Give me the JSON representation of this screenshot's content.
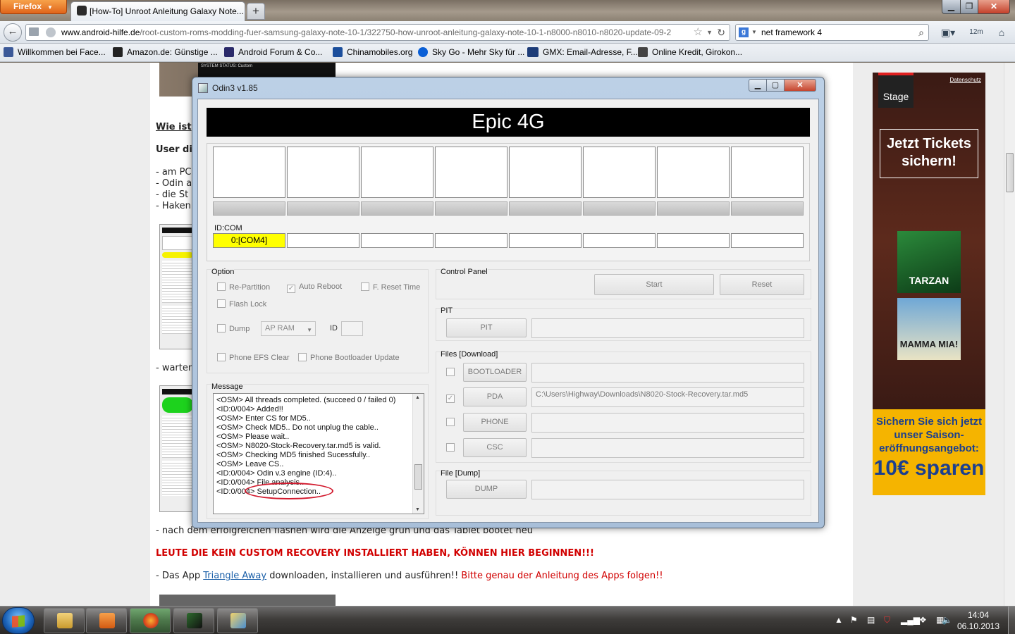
{
  "browser": {
    "menu_button": "Firefox",
    "tab_title": "[How-To] Unroot Anleitung Galaxy Note...",
    "new_tab": "+",
    "url_host": "www.android-hilfe.de",
    "url_path": "/root-custom-roms-modding-fuer-samsung-galaxy-note-10-1/322750-how-unroot-anleitung-galaxy-note-10-1-n8000-n8010-n8020-update-09-2",
    "search_value": "net framework 4",
    "bookmarks": [
      {
        "label": "Willkommen bei Face...",
        "color": "#3b5998"
      },
      {
        "label": "Amazon.de: Günstige ...",
        "color": "#222222"
      },
      {
        "label": "Android Forum & Co...",
        "color": "#2a2a6a"
      },
      {
        "label": "Chinamobiles.org",
        "color": "#1c4f9c"
      },
      {
        "label": "Sky Go - Mehr Sky für ...",
        "color": "#0a5fd6"
      },
      {
        "label": "GMX: Email-Adresse, F...",
        "color": "#1d3c78"
      },
      {
        "label": "Online Kredit, Girokon...",
        "color": "#444444"
      }
    ]
  },
  "page": {
    "image_caption": "SYSTEM STATUS: Custom",
    "heading_1": "Wie ist",
    "heading_2": "User di",
    "list_items": [
      "- am PC",
      "- Odin a",
      "- die St",
      "- Haken"
    ],
    "warten": "- warten",
    "nach_line": "- nach dem erfolgreichen flashen wird die Anzeige grün und das Tablet bootet neu",
    "leute_line": "LEUTE DIE KEIN CUSTOM RECOVERY INSTALLIERT HABEN, KÖNNEN HIER BEGINNEN!!!",
    "app_prefix": "- Das App ",
    "app_link": "Triangle Away",
    "app_middle": " downloaden, installieren und ausführen!! ",
    "app_red": "Bitte genau der Anleitung des Apps folgen!!"
  },
  "ad": {
    "brand": "Stage",
    "privacy": "Datenschutz",
    "tickets": "Jetzt Tickets sichern!",
    "show_1": "TARZAN",
    "show_2": "MAMMA MIA!",
    "offer_1": "Sichern Sie sich jetzt unser Saison-eröffnungsangebot:",
    "offer_2": "10€ sparen"
  },
  "odin": {
    "title": "Odin3 v1.85",
    "banner": "Epic 4G",
    "idcom_label": "ID:COM",
    "com_slots": [
      "0:[COM4]",
      "",
      "",
      "",
      "",
      "",
      "",
      ""
    ],
    "option_label": "Option",
    "options": {
      "re_partition": "Re-Partition",
      "auto_reboot": "Auto Reboot",
      "f_reset_time": "F. Reset Time",
      "flash_lock": "Flash Lock",
      "dump": "Dump",
      "dump_select": "AP RAM",
      "id_label": "ID",
      "phone_efs_clear": "Phone EFS Clear",
      "phone_bootloader_update": "Phone Bootloader Update"
    },
    "checked": {
      "re_partition": false,
      "auto_reboot": true,
      "f_reset_time": false,
      "flash_lock": false,
      "dump": false,
      "phone_efs_clear": false,
      "phone_bootloader_update": false,
      "pda": true
    },
    "message_label": "Message",
    "messages": [
      "<OSM> All threads completed. (succeed 0 / failed 0)",
      "<ID:0/004> Added!!",
      "<OSM> Enter CS for MD5..",
      "<OSM> Check MD5.. Do not unplug the cable..",
      "<OSM> Please wait..",
      "<OSM> N8020-Stock-Recovery.tar.md5 is valid.",
      "<OSM> Checking MD5 finished Sucessfully..",
      "<OSM> Leave CS..",
      "<ID:0/004> Odin v.3 engine (ID:4)..",
      "<ID:0/004> File analysis..",
      "<ID:0/004> SetupConnection.."
    ],
    "control_panel_label": "Control Panel",
    "start": "Start",
    "reset": "Reset",
    "pit_label": "PIT",
    "pit_button": "PIT",
    "files_label": "Files [Download]",
    "bootloader": "BOOTLOADER",
    "pda": "PDA",
    "pda_path": "C:\\Users\\Highway\\Downloads\\N8020-Stock-Recovery.tar.md5",
    "phone": "PHONE",
    "csc": "CSC",
    "file_dump_label": "File [Dump]",
    "dump_button": "DUMP"
  },
  "taskbar": {
    "time": "14:04",
    "date": "06.10.2013"
  }
}
